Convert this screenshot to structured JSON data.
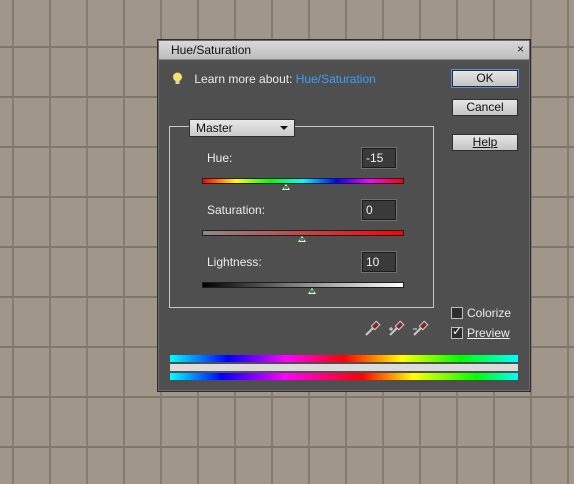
{
  "dialog": {
    "title": "Hue/Saturation",
    "close_glyph": "×",
    "learn_prefix": "Learn more about:",
    "learn_link": "Hue/Saturation",
    "buttons": {
      "ok": "OK",
      "cancel": "Cancel",
      "help": "Help"
    },
    "channel": "Master",
    "hue": {
      "label": "Hue:",
      "value": "-15",
      "slider_fraction": 0.42
    },
    "saturation": {
      "label": "Saturation:",
      "value": "0",
      "slider_fraction": 0.5
    },
    "lightness": {
      "label": "Lightness:",
      "value": "10",
      "slider_fraction": 0.55
    },
    "colorize": {
      "label": "Colorize",
      "checked": false
    },
    "preview": {
      "label": "Preview",
      "checked": true
    },
    "icons": [
      "lightbulb-icon",
      "eyedropper-icon",
      "eyedropper-plus-icon",
      "eyedropper-minus-icon"
    ],
    "accent_link_color": "#3aa0ff"
  }
}
